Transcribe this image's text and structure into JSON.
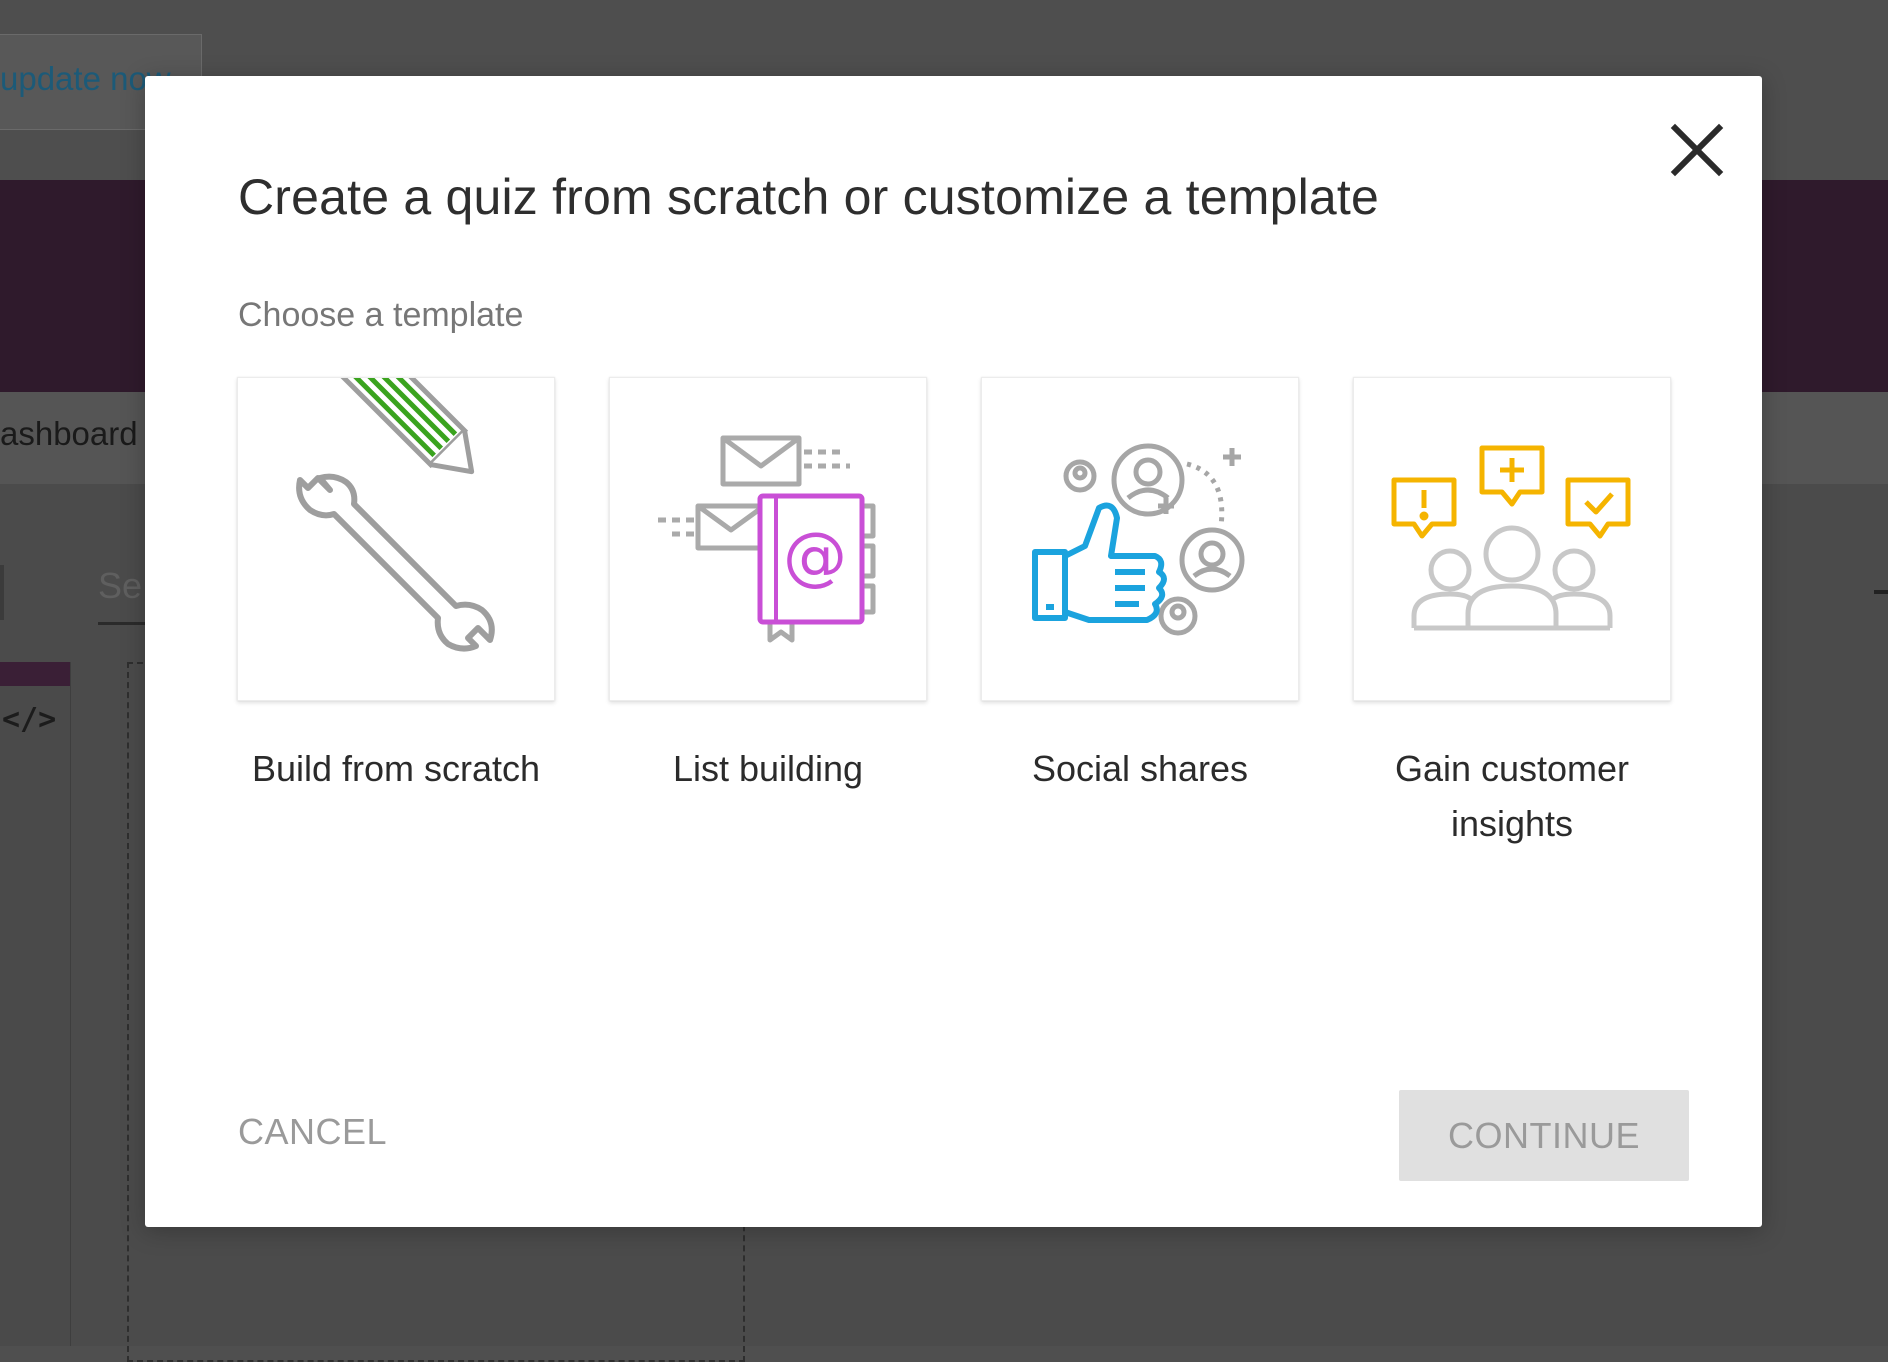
{
  "background": {
    "update_link": "update now",
    "nav_dashboard": "ashboard",
    "search_fragment": "Se",
    "code_icon": "</>"
  },
  "modal": {
    "title": "Create a quiz from scratch or customize a template",
    "section_label": "Choose a template",
    "close_icon": "close-icon",
    "templates": [
      {
        "label": "Build from scratch",
        "icon": "pencil-wrench-icon",
        "color": "#3aa31e"
      },
      {
        "label": "List building",
        "icon": "email-address-book-icon",
        "color": "#c94fd6"
      },
      {
        "label": "Social shares",
        "icon": "thumbs-up-share-icon",
        "color": "#1ba3de"
      },
      {
        "label": "Gain customer insights",
        "icon": "customer-feedback-icon",
        "color": "#f5b400"
      }
    ],
    "cancel_label": "CANCEL",
    "continue_label": "CONTINUE"
  }
}
